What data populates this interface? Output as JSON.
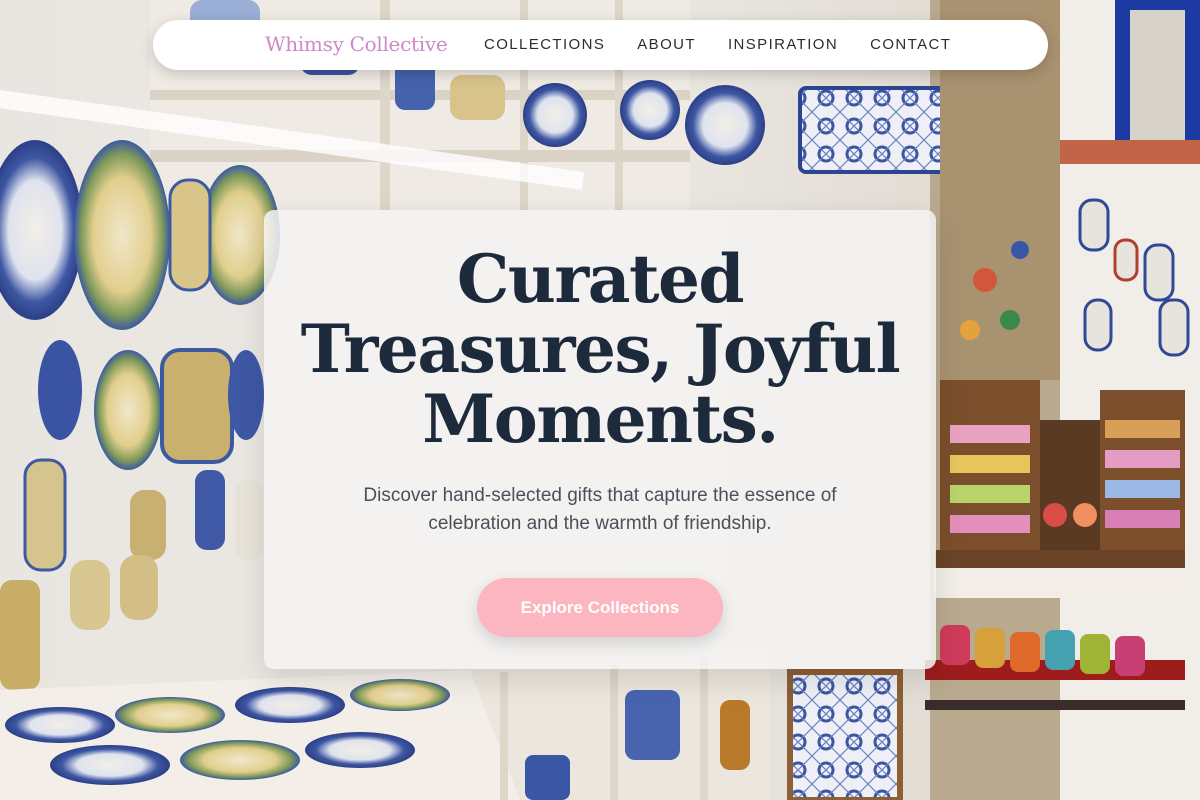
{
  "nav": {
    "brand": "Whimsy Collective",
    "links": [
      {
        "label": "COLLECTIONS"
      },
      {
        "label": "ABOUT"
      },
      {
        "label": "INSPIRATION"
      },
      {
        "label": "CONTACT"
      }
    ]
  },
  "hero": {
    "title_lines": [
      "Curated",
      "Treasures, Joyful",
      "Moments."
    ],
    "subtitle_lines": [
      "Discover hand-selected gifts that capture the essence of",
      "celebration and the warmth of friendship."
    ],
    "cta_label": "Explore Collections"
  },
  "colors": {
    "brand": "#cf89c8",
    "title": "#1c2a3b",
    "cta": "#fbb6c1"
  }
}
